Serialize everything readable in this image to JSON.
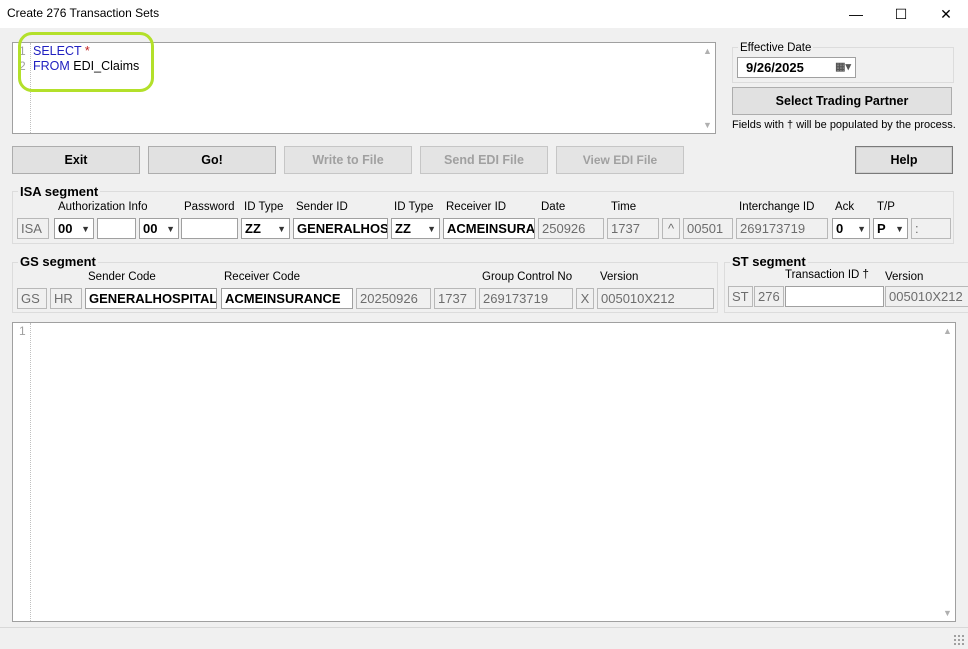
{
  "window": {
    "title": "Create 276 Transaction Sets",
    "minimize_glyph": "—",
    "maximize_glyph": "☐",
    "close_glyph": "✕"
  },
  "query_editor": {
    "line_numbers": [
      "1",
      "2"
    ],
    "line1_keyword": "SELECT",
    "line1_rest": "*",
    "line2_keyword": "FROM",
    "line2_rest": "EDI_Claims"
  },
  "effective_date": {
    "label": "Effective Date",
    "value": "9/26/2025"
  },
  "trading_partner_button": "Select Trading Partner",
  "note": "Fields with † will be populated by the process.",
  "buttons": {
    "exit": "Exit",
    "go": "Go!",
    "write_to_file": "Write to File",
    "send_edi_file": "Send EDI File",
    "view_edi_file": "View EDI File",
    "help": "Help"
  },
  "isa": {
    "title": "ISA segment",
    "labels": {
      "auth_info": "Authorization Info",
      "password": "Password",
      "id_type1": "ID Type",
      "sender_id": "Sender ID",
      "id_type2": "ID Type",
      "receiver_id": "Receiver ID",
      "date": "Date",
      "time": "Time",
      "interchange_id": "Interchange ID",
      "ack": "Ack",
      "tp": "T/P"
    },
    "values": {
      "segment": "ISA",
      "auth_qual": "00",
      "auth_info": "",
      "pass_qual": "00",
      "password": "",
      "sender_id_type": "ZZ",
      "sender_id": "GENERALHOSPITAL",
      "receiver_id_type": "ZZ",
      "receiver_id": "ACMEINSURANCE",
      "date": "250926",
      "time": "1737",
      "repetition_sep": "^",
      "version": "00501",
      "interchange_id": "269173719",
      "ack": "0",
      "tp": "P",
      "component_sep": ":"
    }
  },
  "gs": {
    "title": "GS segment",
    "labels": {
      "sender_code": "Sender Code",
      "receiver_code": "Receiver Code",
      "group_control_no": "Group Control No",
      "version": "Version"
    },
    "values": {
      "segment": "GS",
      "functional_id": "HR",
      "sender_code": "GENERALHOSPITAL",
      "receiver_code": "ACMEINSURANCE",
      "date": "20250926",
      "time": "1737",
      "group_control_no": "269173719",
      "agency": "X",
      "version": "005010X212"
    }
  },
  "st": {
    "title": "ST segment",
    "labels": {
      "transaction_id": "Transaction ID †",
      "version": "Version"
    },
    "values": {
      "segment": "ST",
      "transaction_set": "276",
      "transaction_id": "",
      "version": "005010X212"
    }
  },
  "output_editor": {
    "line_numbers": [
      "1"
    ]
  }
}
